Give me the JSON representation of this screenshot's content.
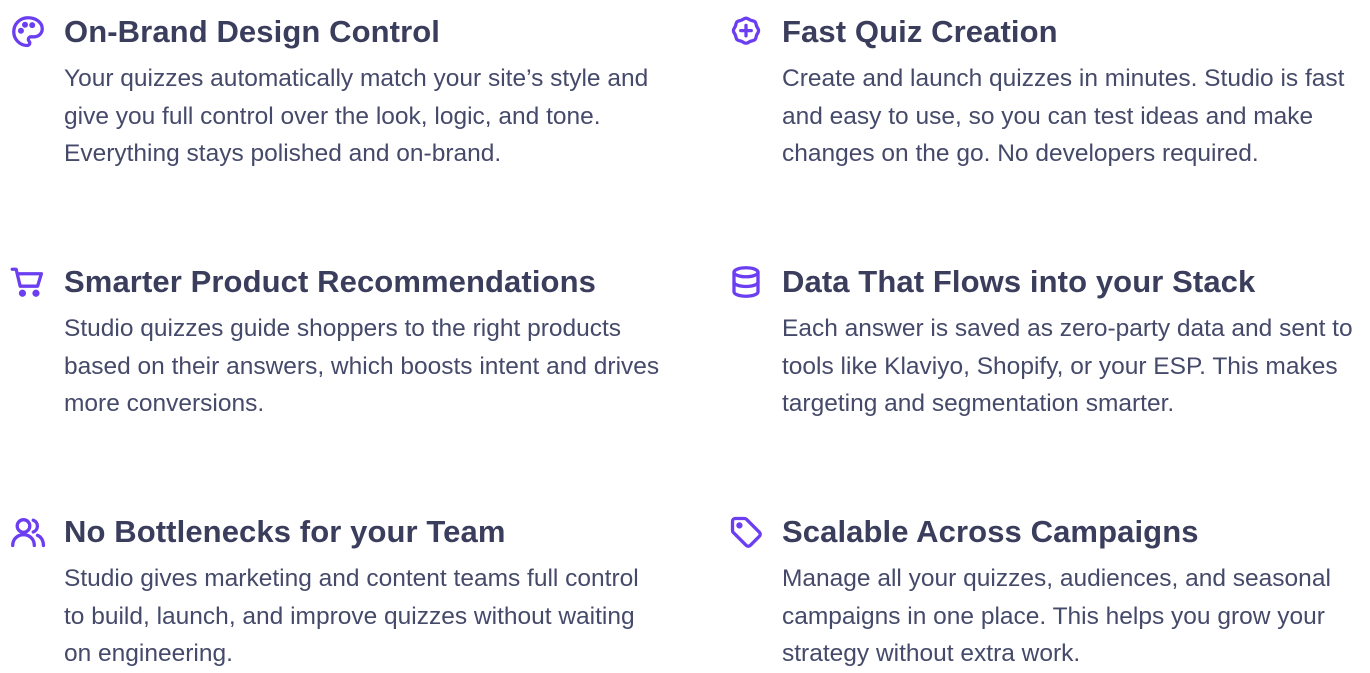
{
  "accent_color": "#6b3ef2",
  "features": [
    {
      "icon": "palette-icon",
      "title": "On-Brand Design Control",
      "description": "Your quizzes automatically match your site’s style and give you full control over the look, logic, and tone. Everything stays polished and on-brand."
    },
    {
      "icon": "plus-circle-icon",
      "title": "Fast Quiz Creation",
      "description": "Create and launch quizzes in minutes. Studio is fast and easy to use, so you can test ideas and make changes on the go. No developers required."
    },
    {
      "icon": "shopping-cart-icon",
      "title": "Smarter Product Recommendations",
      "description": "Studio quizzes guide shoppers to the right products based on their answers, which boosts intent and drives more conversions."
    },
    {
      "icon": "database-icon",
      "title": "Data That Flows into your Stack",
      "description": "Each answer is saved as zero-party data and sent to tools like Klaviyo, Shopify, or your ESP. This makes targeting and segmentation smarter."
    },
    {
      "icon": "users-icon",
      "title": "No Bottlenecks for your Team",
      "description": "Studio gives marketing and content teams full control to build, launch, and improve quizzes without waiting on engineering."
    },
    {
      "icon": "tag-icon",
      "title": "Scalable Across Campaigns",
      "description": "Manage all your quizzes, audiences, and seasonal campaigns in one place. This helps you grow your strategy without extra work."
    }
  ]
}
